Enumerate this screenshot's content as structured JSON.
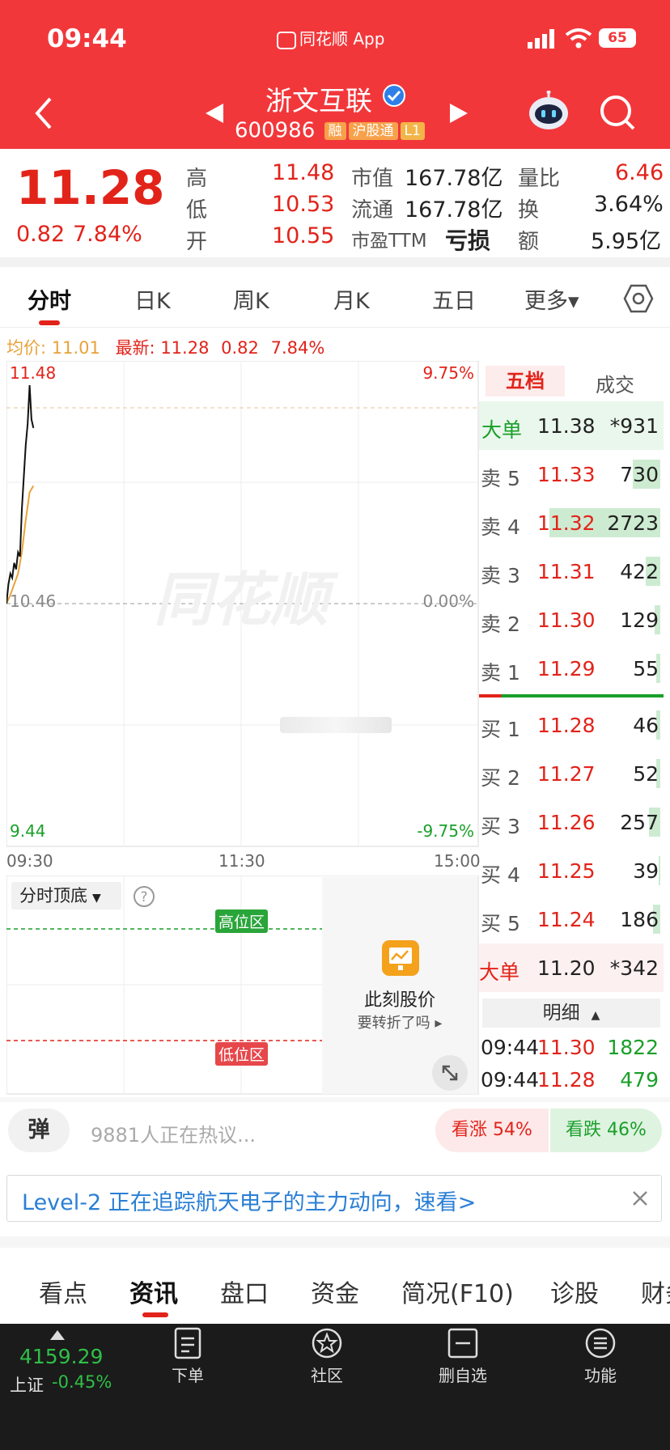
{
  "status_bar": {
    "time": "09:44",
    "app_label": "同花顺 App",
    "battery": "65"
  },
  "header": {
    "stock_name": "浙文互联",
    "stock_code": "600986",
    "tags": [
      "融",
      "沪股通",
      "L1"
    ]
  },
  "quote": {
    "price": "11.28",
    "change": "0.82",
    "change_pct": "7.84%",
    "high_label": "高",
    "high": "11.48",
    "low_label": "低",
    "low": "10.53",
    "open_label": "开",
    "open": "10.55",
    "mktcap_label": "市值",
    "mktcap": "167.78亿",
    "float_label": "流通",
    "float": "167.78亿",
    "pe_label": "市盈TTM",
    "pe": "亏损",
    "vol_ratio_label": "量比",
    "vol_ratio": "6.46",
    "turnover_label": "换",
    "turnover": "3.64%",
    "amount_label": "额",
    "amount": "5.95亿"
  },
  "chart_tabs": [
    {
      "label": "分时",
      "active": true
    },
    {
      "label": "日K"
    },
    {
      "label": "周K"
    },
    {
      "label": "月K"
    },
    {
      "label": "五日"
    },
    {
      "label": "更多▾"
    }
  ],
  "chart_info": {
    "avg_label": "均价: 11.01",
    "latest_label": "最新: 11.28",
    "change": "0.82",
    "change_pct": "7.84%"
  },
  "chart_data": {
    "type": "line",
    "y_left_top": "11.48",
    "y_left_mid": "10.46",
    "y_left_bottom": "9.44",
    "y_right_top": "9.75%",
    "y_right_mid": "0.00%",
    "y_right_bottom": "-9.75%",
    "x_ticks": [
      "09:30",
      "11:30",
      "15:00"
    ],
    "watermark": "同花顺",
    "ylim": [
      9.44,
      11.48
    ],
    "prev_close": 10.46,
    "minutes_total": 240,
    "series": [
      {
        "name": "价格",
        "color": "#111111",
        "points": [
          [
            0,
            10.46
          ],
          [
            1,
            10.55
          ],
          [
            2,
            10.6
          ],
          [
            3,
            10.58
          ],
          [
            4,
            10.65
          ],
          [
            5,
            10.62
          ],
          [
            6,
            10.7
          ],
          [
            7,
            10.68
          ],
          [
            8,
            10.9
          ],
          [
            9,
            11.05
          ],
          [
            10,
            11.2
          ],
          [
            11,
            11.3
          ],
          [
            12,
            11.48
          ],
          [
            13,
            11.32
          ],
          [
            14,
            11.28
          ]
        ]
      },
      {
        "name": "均价",
        "color": "#e8a23a",
        "points": [
          [
            0,
            10.46
          ],
          [
            2,
            10.5
          ],
          [
            4,
            10.55
          ],
          [
            6,
            10.6
          ],
          [
            8,
            10.7
          ],
          [
            10,
            10.85
          ],
          [
            12,
            10.98
          ],
          [
            14,
            11.01
          ]
        ]
      }
    ]
  },
  "indicator": {
    "selector_label": "分时顶底",
    "high_zone": "高位区",
    "low_zone": "低位区"
  },
  "ad_card": {
    "title": "此刻股价",
    "subtitle": "要转折了吗"
  },
  "orderbook": {
    "tab_five": "五档",
    "tab_deal": "成交",
    "big_sell": {
      "label": "大单",
      "price": "11.38",
      "vol": "*931"
    },
    "sells": [
      {
        "label": "卖 5",
        "price": "11.33",
        "vol": "730",
        "bar": 0.15
      },
      {
        "label": "卖 4",
        "price": "11.32",
        "vol": "2723",
        "bar": 0.6
      },
      {
        "label": "卖 3",
        "price": "11.31",
        "vol": "422",
        "bar": 0.08
      },
      {
        "label": "卖 2",
        "price": "11.30",
        "vol": "129",
        "bar": 0.03
      },
      {
        "label": "卖 1",
        "price": "11.29",
        "vol": "55",
        "bar": 0.02
      }
    ],
    "buys": [
      {
        "label": "买 1",
        "price": "11.28",
        "vol": "46",
        "bar": 0.02
      },
      {
        "label": "买 2",
        "price": "11.27",
        "vol": "52",
        "bar": 0.02
      },
      {
        "label": "买 3",
        "price": "11.26",
        "vol": "257",
        "bar": 0.06
      },
      {
        "label": "买 4",
        "price": "11.25",
        "vol": "39",
        "bar": 0.01
      },
      {
        "label": "买 5",
        "price": "11.24",
        "vol": "186",
        "bar": 0.04
      }
    ],
    "big_buy": {
      "label": "大单",
      "price": "11.20",
      "vol": "*342"
    },
    "detail_label": "明细",
    "trades": [
      {
        "time": "09:44",
        "price": "11.30",
        "vol": "1822"
      },
      {
        "time": "09:44",
        "price": "11.28",
        "vol": "479"
      }
    ]
  },
  "discussion": {
    "danmu": "弹",
    "text": "9881人正在热议...",
    "bull": "看涨 54%",
    "bear": "看跌 46%"
  },
  "banner": {
    "text": "Level-2 正在追踪航天电子的主力动向，速看>"
  },
  "bottom_tabs": [
    "看点",
    "资讯",
    "盘口",
    "资金",
    "简况(F10)",
    "诊股",
    "财务"
  ],
  "bottom_nav": {
    "index_value": "4159.29",
    "index_name": "上证",
    "index_change": "-0.45%",
    "items": [
      "下单",
      "社区",
      "删自选",
      "功能"
    ]
  }
}
